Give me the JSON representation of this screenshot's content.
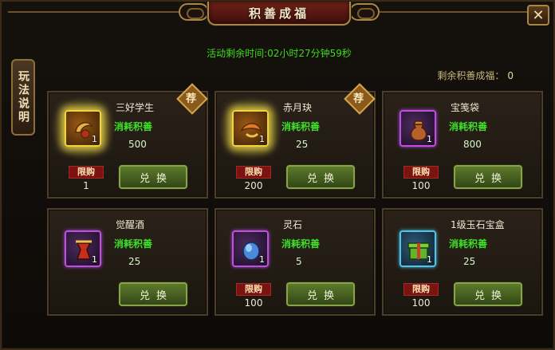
{
  "title": "积善成福",
  "close_label": "✕",
  "rules_tab": "玩法说明",
  "timer_text": "活动剩余时间:02小时27分钟59秒",
  "remain": {
    "label": "剩余积善成福：",
    "value": "0"
  },
  "cost_label": "消耗积善",
  "limit_label": "限购",
  "exchange_label": "兑换",
  "recommend_label": "荐",
  "items": [
    {
      "name": "三好学生",
      "cost": "500",
      "qty": "1",
      "limit": "1"
    },
    {
      "name": "赤月玦",
      "cost": "25",
      "qty": "1",
      "limit": "200"
    },
    {
      "name": "宝笺袋",
      "cost": "800",
      "qty": "1",
      "limit": "100"
    },
    {
      "name": "觉醒酒",
      "cost": "25",
      "qty": "1"
    },
    {
      "name": "灵石",
      "cost": "5",
      "qty": "1",
      "limit": "100"
    },
    {
      "name": "1级玉石宝盒",
      "cost": "25",
      "qty": "1",
      "limit": "100"
    }
  ]
}
